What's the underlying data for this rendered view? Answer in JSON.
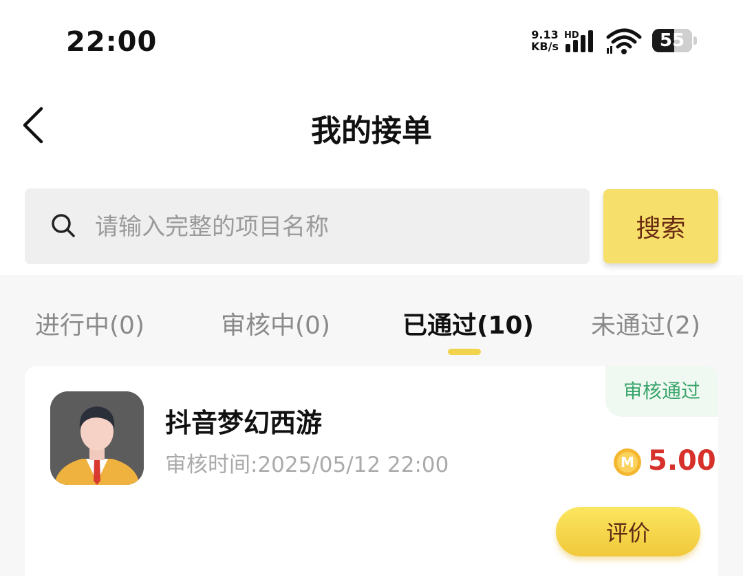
{
  "status_bar": {
    "time": "22:00",
    "net_speed_value": "9.13",
    "net_speed_unit": "KB/s",
    "network_type": "HD",
    "battery_level": "55",
    "icons": [
      "signal-icon",
      "wifi-icon",
      "battery-icon"
    ]
  },
  "header": {
    "title": "我的接单",
    "back_icon": "chevron-left-icon"
  },
  "search": {
    "placeholder": "请输入完整的项目名称",
    "value": "",
    "button_label": "搜索",
    "icon": "search-icon"
  },
  "tabs": [
    {
      "label": "进行中(0)",
      "active": false
    },
    {
      "label": "审核中(0)",
      "active": false
    },
    {
      "label": "已通过(10)",
      "active": true
    },
    {
      "label": "未通过(2)",
      "active": false
    }
  ],
  "orders": [
    {
      "name": "抖音梦幻西游",
      "review_time_label": "审核时间:2025/05/12 22:00",
      "status": "审核通过",
      "reward": "5.00",
      "coin_icon_letter": "M",
      "action_label": "评价"
    }
  ],
  "colors": {
    "accent_yellow": "#f6df6a",
    "tab_indicator": "#f1d34e",
    "reward_red": "#d6312a",
    "status_green": "#3aa56b",
    "button_text_brown": "#6a2b13"
  }
}
